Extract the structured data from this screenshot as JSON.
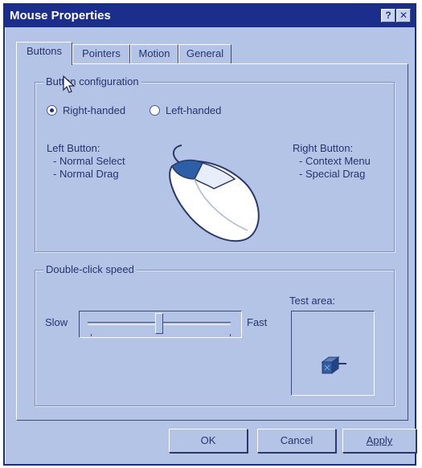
{
  "window": {
    "title": "Mouse Properties",
    "help_glyph": "?",
    "close_glyph": "✕"
  },
  "tabs": [
    {
      "label": "Buttons",
      "active": true
    },
    {
      "label": "Pointers",
      "active": false
    },
    {
      "label": "Motion",
      "active": false
    },
    {
      "label": "General",
      "active": false
    }
  ],
  "button_config": {
    "title": "Button configuration",
    "radio_right_label": "Right-handed",
    "radio_left_label": "Left-handed",
    "selected": "Right-handed",
    "left_button": {
      "heading": "Left Button:",
      "items": [
        "- Normal Select",
        "- Normal Drag"
      ]
    },
    "right_button": {
      "heading": "Right Button:",
      "items": [
        "- Context Menu",
        "- Special Drag"
      ]
    }
  },
  "double_click": {
    "title": "Double-click speed",
    "slow_label": "Slow",
    "fast_label": "Fast",
    "slider_level": 0.5,
    "test_area_label": "Test area:"
  },
  "footer": {
    "ok_label": "OK",
    "cancel_label": "Cancel",
    "apply_label": "Apply"
  },
  "colors": {
    "face": "#b4c4e6",
    "titlebar": "#1c2e8c",
    "text": "#26336e"
  }
}
